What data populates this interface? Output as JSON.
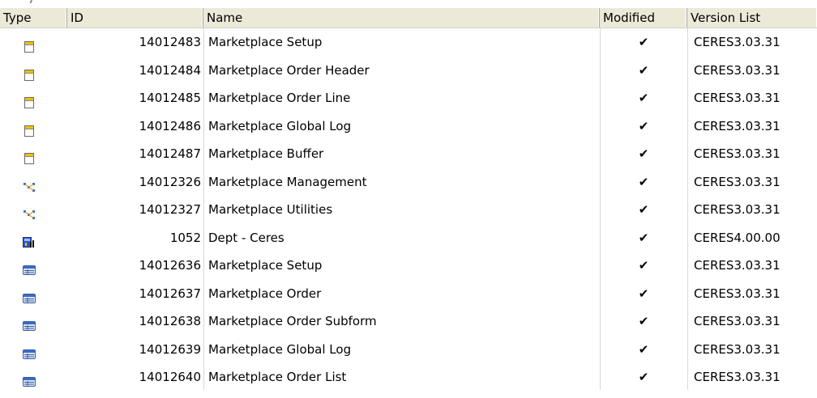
{
  "columns": {
    "type": "Type",
    "id": "ID",
    "name": "Name",
    "modified": "Modified",
    "version": "Version List"
  },
  "rows": [
    {
      "icon": "table-icon",
      "id": "14012483",
      "name": "Marketplace Setup",
      "modified": "✔",
      "version": "CERES3.03.31"
    },
    {
      "icon": "table-icon",
      "id": "14012484",
      "name": "Marketplace Order Header",
      "modified": "✔",
      "version": "CERES3.03.31"
    },
    {
      "icon": "table-icon",
      "id": "14012485",
      "name": "Marketplace Order Line",
      "modified": "✔",
      "version": "CERES3.03.31"
    },
    {
      "icon": "table-icon",
      "id": "14012486",
      "name": "Marketplace Global Log",
      "modified": "✔",
      "version": "CERES3.03.31"
    },
    {
      "icon": "table-icon",
      "id": "14012487",
      "name": "Marketplace Buffer",
      "modified": "✔",
      "version": "CERES3.03.31"
    },
    {
      "icon": "codeunit-icon",
      "id": "14012326",
      "name": "Marketplace Management",
      "modified": "✔",
      "version": "CERES3.03.31"
    },
    {
      "icon": "codeunit-icon",
      "id": "14012327",
      "name": "Marketplace Utilities",
      "modified": "✔",
      "version": "CERES3.03.31"
    },
    {
      "icon": "report-icon",
      "id": "1052",
      "name": "Dept - Ceres",
      "modified": "✔",
      "version": "CERES4.00.00"
    },
    {
      "icon": "form-icon",
      "id": "14012636",
      "name": "Marketplace Setup",
      "modified": "✔",
      "version": "CERES3.03.31"
    },
    {
      "icon": "form-icon",
      "id": "14012637",
      "name": "Marketplace Order",
      "modified": "✔",
      "version": "CERES3.03.31"
    },
    {
      "icon": "form-icon",
      "id": "14012638",
      "name": "Marketplace Order Subform",
      "modified": "✔",
      "version": "CERES3.03.31"
    },
    {
      "icon": "form-icon",
      "id": "14012639",
      "name": "Marketplace Global Log",
      "modified": "✔",
      "version": "CERES3.03.31"
    },
    {
      "icon": "form-icon",
      "id": "14012640",
      "name": "Marketplace Order List",
      "modified": "✔",
      "version": "CERES3.03.31"
    }
  ]
}
